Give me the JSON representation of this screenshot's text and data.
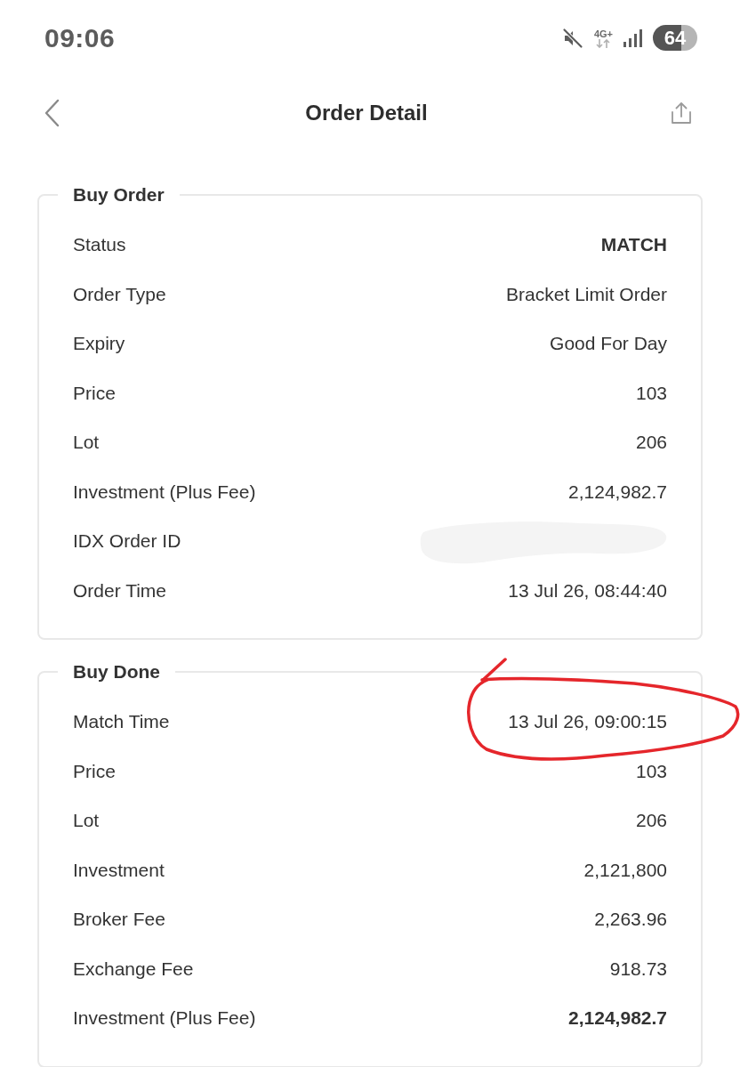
{
  "status_bar": {
    "time": "09:06",
    "network": "4G+",
    "battery": "64"
  },
  "header": {
    "title": "Order Detail"
  },
  "sections": [
    {
      "title": "Buy Order",
      "rows": [
        {
          "label": "Status",
          "value": "MATCH",
          "kind": "strong",
          "circled": false
        },
        {
          "label": "Order Type",
          "value": "Bracket Limit Order",
          "kind": "text",
          "circled": false
        },
        {
          "label": "Expiry",
          "value": "Good For Day",
          "kind": "text",
          "circled": false
        },
        {
          "label": "Price",
          "value": "103",
          "kind": "text",
          "circled": false
        },
        {
          "label": "Lot",
          "value": "206",
          "kind": "text",
          "circled": false
        },
        {
          "label": "Investment (Plus Fee)",
          "value": "2,124,982.7",
          "kind": "text",
          "circled": false
        },
        {
          "label": "IDX Order ID",
          "kind": "redacted",
          "circled": false
        },
        {
          "label": "Order Time",
          "value": "13 Jul 26, 08:44:40",
          "kind": "text",
          "circled": false
        }
      ]
    },
    {
      "title": "Buy Done",
      "rows": [
        {
          "label": "Match Time",
          "value": "13 Jul 26, 09:00:15",
          "kind": "text",
          "circled": true
        },
        {
          "label": "Price",
          "value": "103",
          "kind": "text",
          "circled": false
        },
        {
          "label": "Lot",
          "value": "206",
          "kind": "text",
          "circled": false
        },
        {
          "label": "Investment",
          "value": "2,121,800",
          "kind": "text",
          "circled": false
        },
        {
          "label": "Broker Fee",
          "value": "2,263.96",
          "kind": "text",
          "circled": false
        },
        {
          "label": "Exchange Fee",
          "value": "918.73",
          "kind": "text",
          "circled": false
        },
        {
          "label": "Investment (Plus Fee)",
          "value": "2,124,982.7",
          "kind": "strong",
          "circled": false
        }
      ]
    }
  ]
}
